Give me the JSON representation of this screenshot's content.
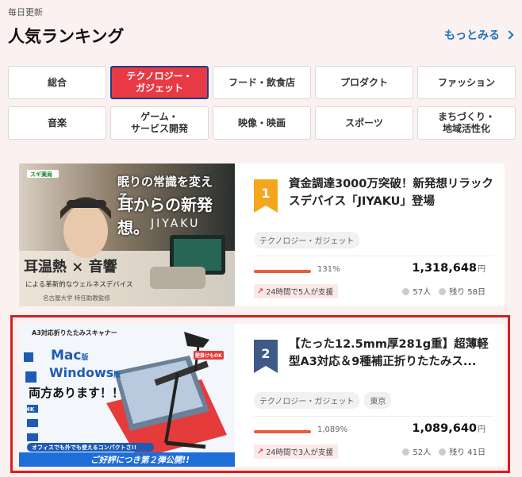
{
  "header": {
    "daily": "毎日更新",
    "title": "人気ランキング",
    "more": "もっとみる"
  },
  "categories": [
    "総合",
    "テクノロジー・\nガジェット",
    "フード・飲食店",
    "プロダクト",
    "ファッション",
    "音楽",
    "ゲーム・\nサービス開発",
    "映像・映画",
    "スポーツ",
    "まちづくり・\n地域活性化"
  ],
  "active_category_index": 1,
  "projects": [
    {
      "rank": "1",
      "title": "資金調達3000万突破！新発想リラックスデバイス「JIYAKU」登場",
      "tags": [
        "テクノロジー・ガジェット"
      ],
      "percent": "131%",
      "progress": 1.0,
      "amount": "1,318,648",
      "yen": "円",
      "trend": "24時間で5人が支援",
      "supporters": "57人",
      "remaining": "残り 58日",
      "badge_color": "#f4a61d",
      "banner": {
        "store": "スギ薬局",
        "headline1": "眠りの常識を変える、",
        "headline2": "耳からの新発想。",
        "brand": "JIYAKU",
        "feature": "耳温熱 × 音響",
        "sub": "による革新的なウェルネスデバイス",
        "credit": "名古屋大学 特任助教監修"
      }
    },
    {
      "rank": "2",
      "title": "【たった12.5mm厚281g重】超薄軽型A3対応＆9種補正折りたたみス...",
      "tags": [
        "テクノロジー・ガジェット",
        "東京"
      ],
      "percent": "1,089%",
      "progress": 1.0,
      "amount": "1,089,640",
      "yen": "円",
      "trend": "24時間で3人が支援",
      "supporters": "52人",
      "remaining": "残り 41日",
      "badge_color": "#3f5a86",
      "banner": {
        "top": "A3対応折りたたみスキャナー",
        "mac": "Mac",
        "mac_suffix": "版",
        "win": "Windows",
        "win_suffix": "版",
        "both": "両方あります！！",
        "office": "オフィスでも外でも使えるコンパクトさ!!",
        "bottom": "ご好評につき第２弾公開!!",
        "badge_4k": "4K",
        "ok": "壁掛けもOK"
      }
    }
  ]
}
